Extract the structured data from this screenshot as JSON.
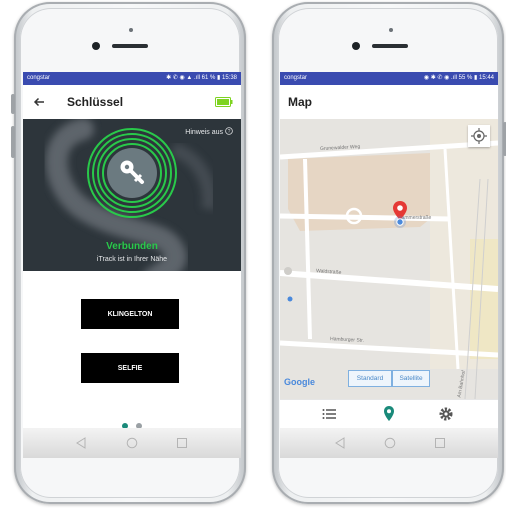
{
  "left_phone": {
    "status_bar": {
      "carrier": "congstar",
      "right": "✱ ✆ ◉ ▲ .ıll 61 % ▮ 15:38"
    },
    "app_bar": {
      "title": "Schlüssel"
    },
    "hint_label": "Hinweis aus",
    "connection_status": "Verbunden",
    "connection_detail": "iTrack ist in Ihrer Nähe",
    "buttons": {
      "ringtone": "KLINGELTON",
      "selfie": "SELFIE"
    },
    "pager": {
      "count": 2,
      "active": 0
    }
  },
  "right_phone": {
    "status_bar": {
      "carrier": "congstar",
      "right": "◉ ✱ ✆ ◉ .ıll 55 % ▮ 15:44"
    },
    "app_bar": {
      "title": "Map"
    },
    "map": {
      "streets": [
        "Grunewalder Weg",
        "Waldstraße",
        "Rammerstraße",
        "Am Bahnhof",
        "Hamburger Str."
      ],
      "attribution": "Google",
      "map_type_buttons": [
        "Standard",
        "Satellite"
      ]
    },
    "bottom_tabs": [
      "list-icon",
      "location-pin-icon",
      "gear-icon"
    ]
  },
  "colors": {
    "status_bar": "#3a4bb0",
    "connected_green": "#29c94a",
    "battery_green": "#7ed321",
    "hero_bg": "#2d353b",
    "map_pin": "#e53935",
    "active_tab": "#1a8a7a",
    "pager_active": "#1a8a7a"
  }
}
